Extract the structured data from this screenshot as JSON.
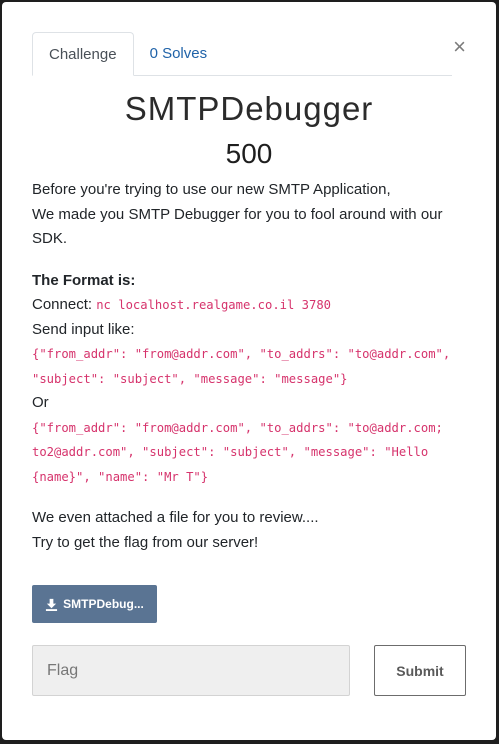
{
  "modal": {
    "close_symbol": "×",
    "tabs": [
      {
        "label": "Challenge",
        "active": true
      },
      {
        "label": "0 Solves",
        "active": false
      }
    ],
    "title": "SMTPDebugger",
    "value": "500",
    "description": {
      "intro_line1": "Before you're trying to use our new SMTP Application,",
      "intro_line2": "We made you SMTP Debugger for you to fool around with our SDK.",
      "format_heading": "The Format is:",
      "connect_label": "Connect:",
      "connect_command": "nc localhost.realgame.co.il 3780",
      "send_input_label": "Send input like:",
      "example1": "{\"from_addr\": \"from@addr.com\", \"to_addrs\": \"to@addr.com\", \"subject\": \"subject\", \"message\": \"message\"}",
      "or_label": "Or",
      "example2": "{\"from_addr\": \"from@addr.com\", \"to_addrs\": \"to@addr.com; to2@addr.com\", \"subject\": \"subject\", \"message\": \"Hello {name}\", \"name\": \"Mr T\"}",
      "outro_line1": "We even attached a file for you to review....",
      "outro_line2": "Try to get the flag from our server!"
    },
    "file_button_label": "SMTPDebug...",
    "file_icon": "download-icon",
    "flag_input": {
      "placeholder": "Flag",
      "value": ""
    },
    "submit_label": "Submit"
  },
  "colors": {
    "file_button_bg": "#5a7493",
    "code_color": "#d6336c",
    "tab_link": "#1f62a8"
  }
}
